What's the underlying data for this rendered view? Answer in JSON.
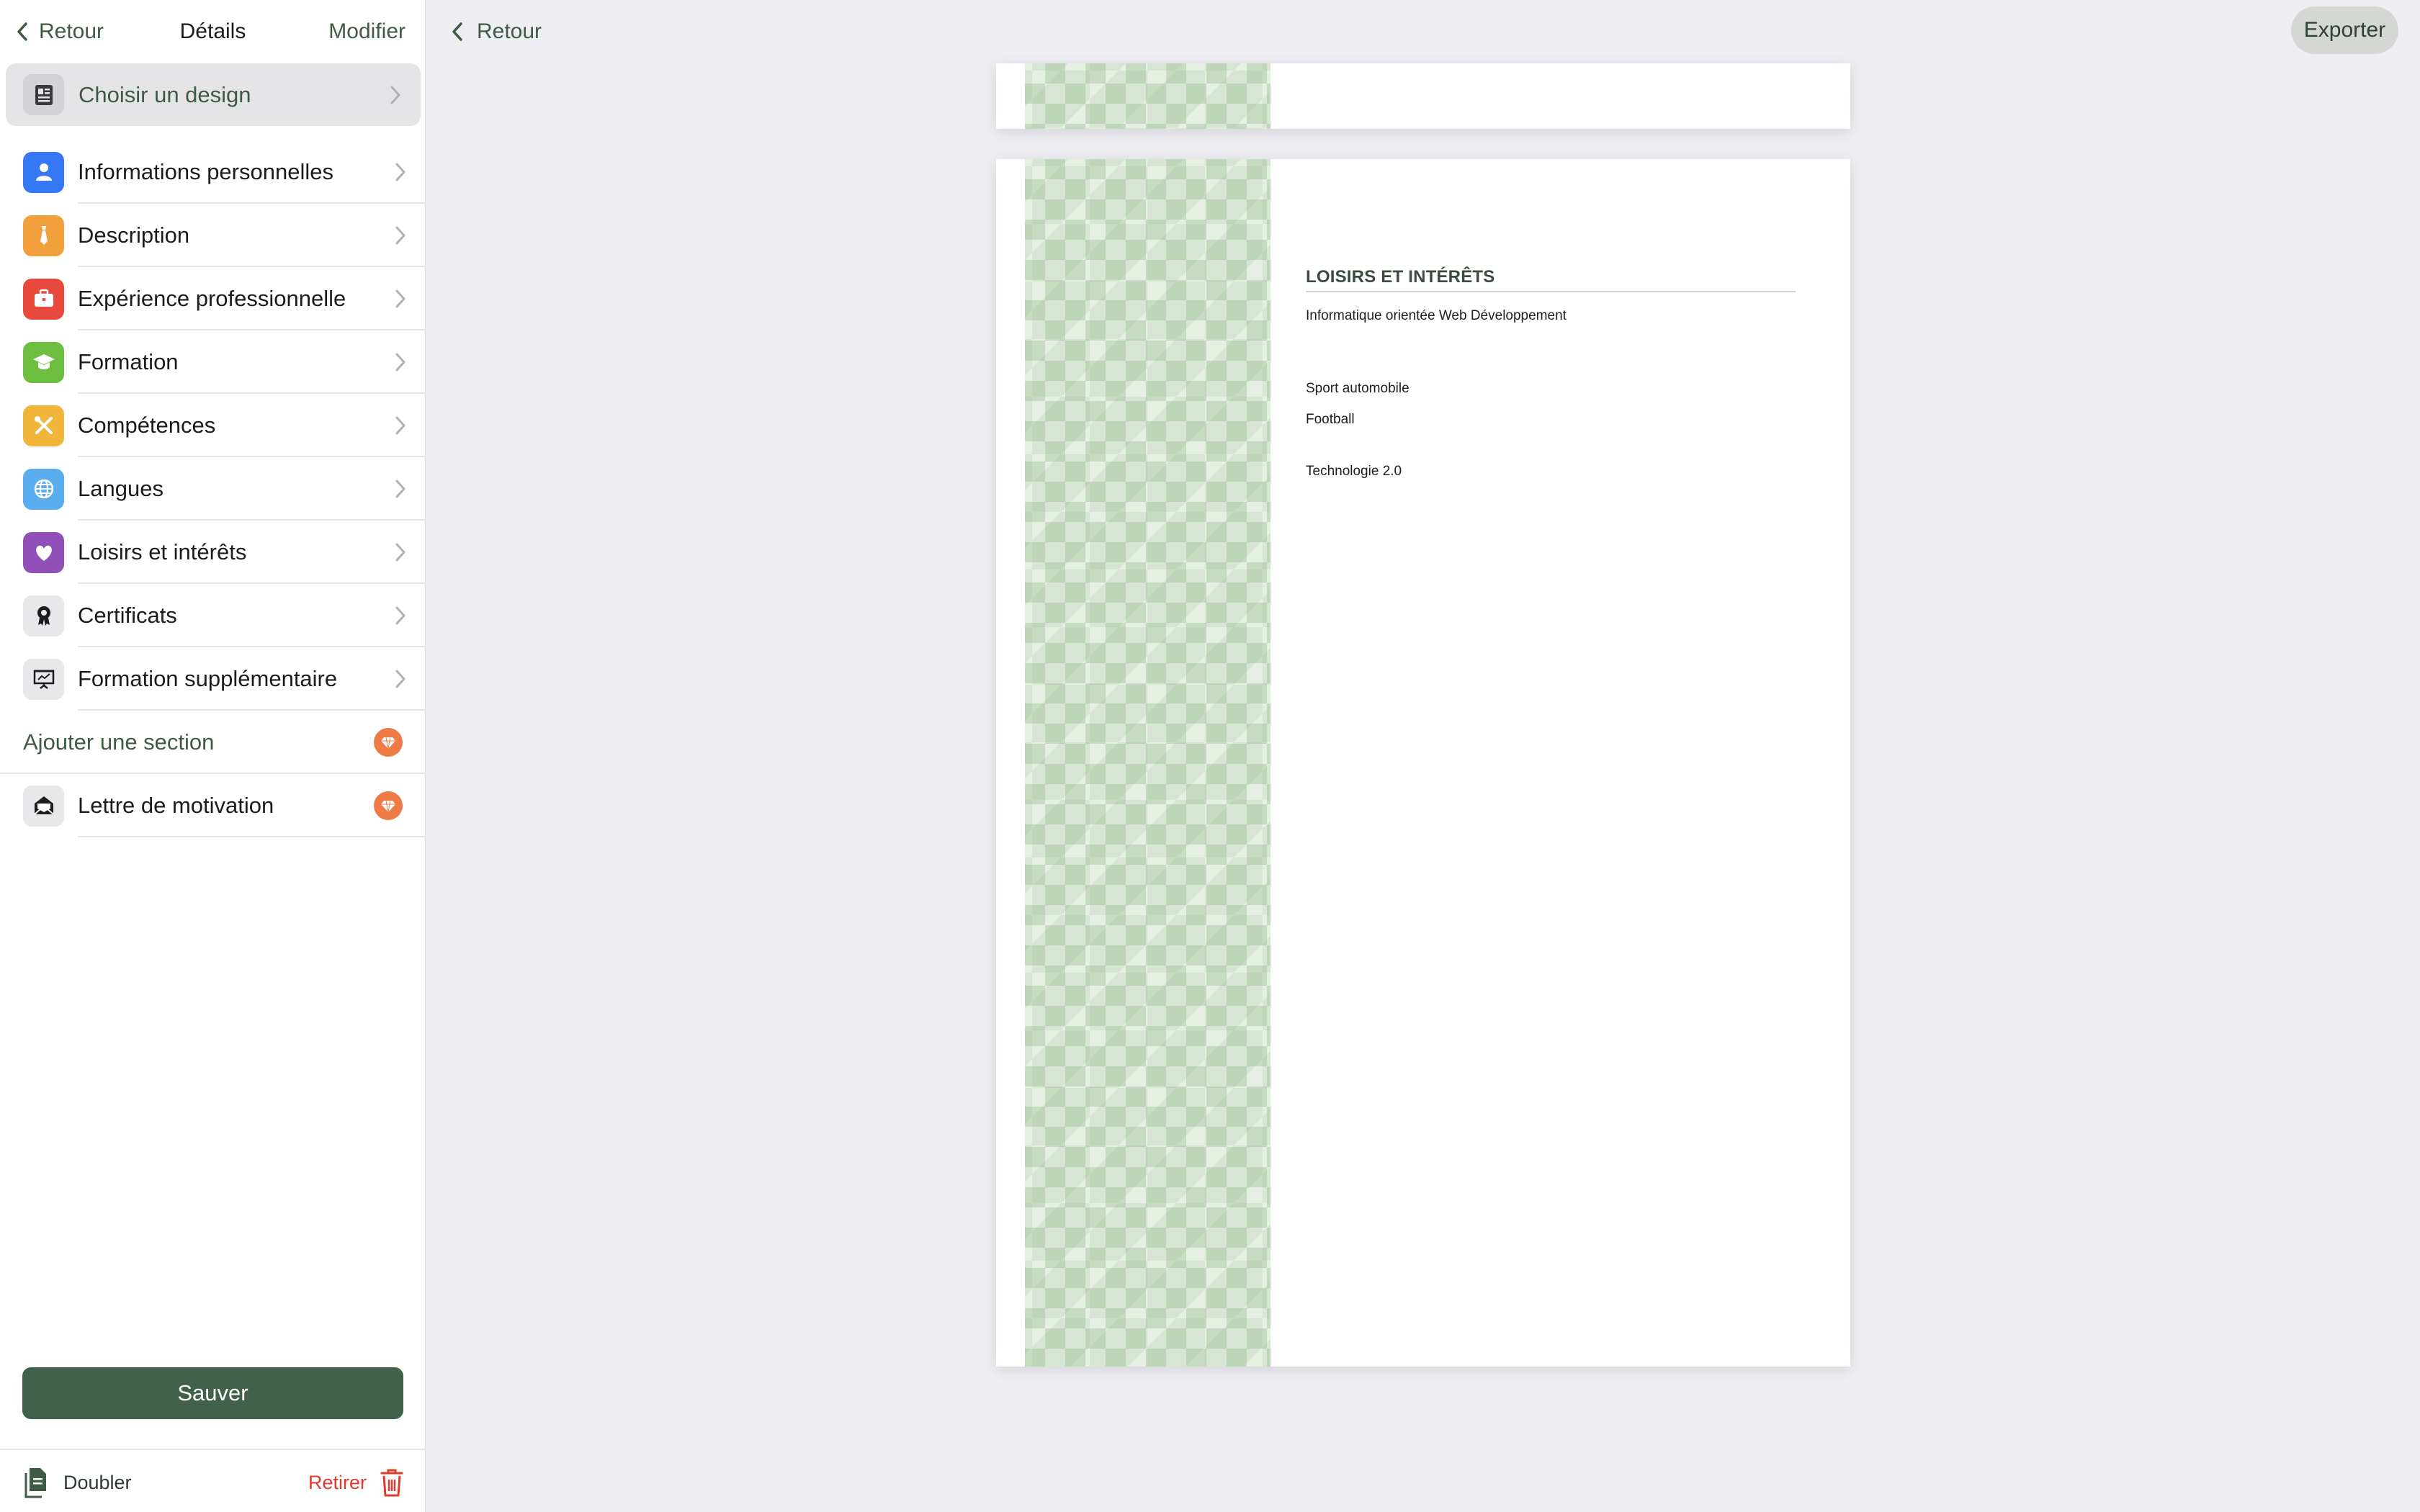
{
  "sidebar": {
    "back_label": "Retour",
    "title": "Détails",
    "edit_label": "Modifier",
    "design_label": "Choisir un design",
    "items": [
      {
        "label": "Informations personnelles",
        "icon": "person-icon",
        "color": "#3478f6"
      },
      {
        "label": "Description",
        "icon": "tie-icon",
        "color": "#f2a03b"
      },
      {
        "label": "Expérience professionnelle",
        "icon": "briefcase-icon",
        "color": "#e8493d"
      },
      {
        "label": "Formation",
        "icon": "graduation-cap-icon",
        "color": "#6cbf3f"
      },
      {
        "label": "Compétences",
        "icon": "tools-icon",
        "color": "#f2b53b"
      },
      {
        "label": "Langues",
        "icon": "globe-icon",
        "color": "#5aaef0"
      },
      {
        "label": "Loisirs et intérêts",
        "icon": "heart-icon",
        "color": "#9150b8"
      },
      {
        "label": "Certificats",
        "icon": "award-icon",
        "color": "#e8e8ea"
      },
      {
        "label": "Formation supplémentaire",
        "icon": "presentation-icon",
        "color": "#e8e8ea"
      }
    ],
    "add_section_label": "Ajouter une section",
    "cover_letter_label": "Lettre de motivation",
    "save_label": "Sauver",
    "duplicate_label": "Doubler",
    "remove_label": "Retirer"
  },
  "main": {
    "back_label": "Retour",
    "export_label": "Exporter"
  },
  "resume": {
    "section_title": "LOISIRS ET INTÉRÊTS",
    "lines": [
      "Informatique orientée Web Développement",
      "Sport automobile",
      "Football",
      "Technologie 2.0"
    ]
  },
  "colors": {
    "accent": "#42614a",
    "premium": "#ee7b45",
    "danger": "#e03a2c"
  }
}
